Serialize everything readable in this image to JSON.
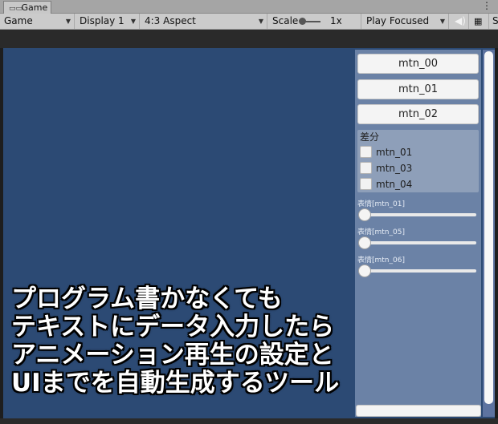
{
  "window": {
    "tab_title": "Game",
    "tab_icon": "gamepad-icon",
    "menu_icon": "kebab-menu-icon"
  },
  "toolbar": {
    "mode": "Game",
    "display": "Display 1",
    "aspect": "4:3 Aspect",
    "scale_label": "Scale",
    "scale_value": "1x",
    "play_mode": "Play Focused",
    "audio_icon": "speaker-icon",
    "stats_icon": "keyboard-icon",
    "stats_label": "S"
  },
  "panel": {
    "buttons": [
      "mtn_00",
      "mtn_01",
      "mtn_02"
    ],
    "diff_title": "差分",
    "checkboxes": [
      {
        "label": "mtn_01",
        "checked": false
      },
      {
        "label": "mtn_03",
        "checked": false
      },
      {
        "label": "mtn_04",
        "checked": false
      }
    ],
    "sliders": [
      {
        "label": "表情[mtn_01]",
        "value": 0
      },
      {
        "label": "表情[mtn_05]",
        "value": 0
      },
      {
        "label": "表情[mtn_06]",
        "value": 0
      }
    ]
  },
  "caption": {
    "lines": [
      "プログラム書かなくても",
      "テキストにデータ入力したら",
      "アニメーション再生の設定と",
      "UIまでを自動生成するツール"
    ]
  },
  "colors": {
    "viewport": "#2c4a74",
    "panel": "#6b82a6",
    "toolbar": "#cbcbcb"
  }
}
